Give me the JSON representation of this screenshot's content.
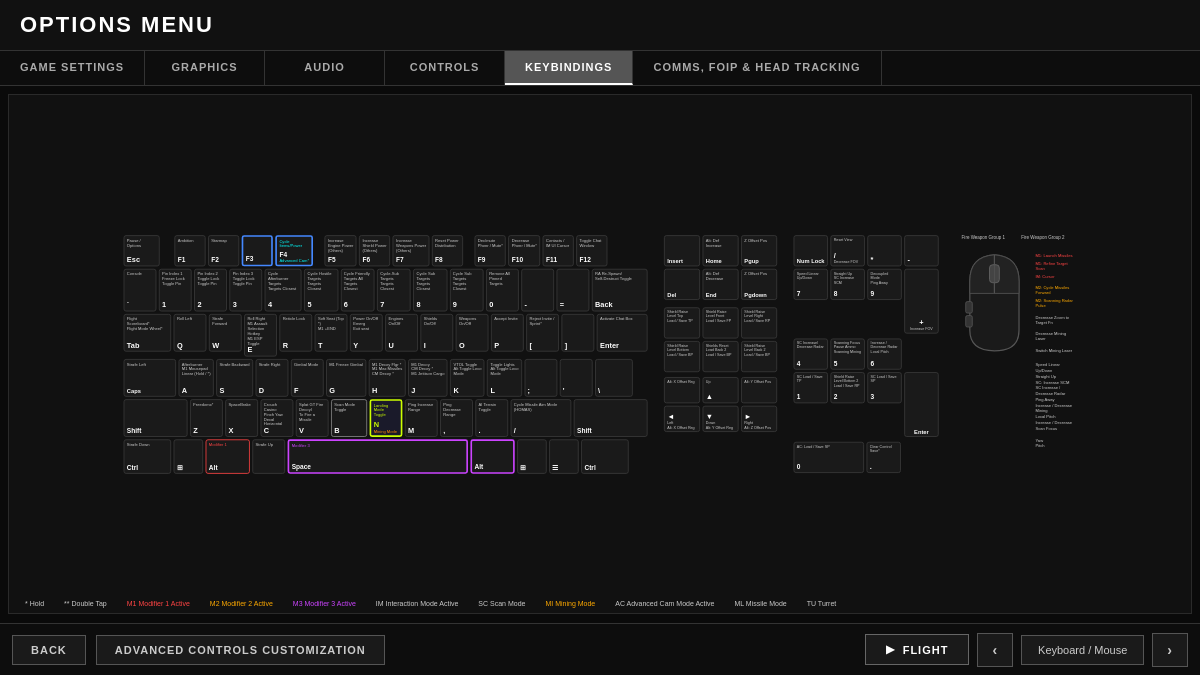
{
  "header": {
    "title": "OPTIONS MENU"
  },
  "nav": {
    "tabs": [
      {
        "label": "GAME SETTINGS",
        "active": false
      },
      {
        "label": "GRAPHICS",
        "active": false
      },
      {
        "label": "AUDIO",
        "active": false
      },
      {
        "label": "CONTROLS",
        "active": false
      },
      {
        "label": "KEYBINDINGS",
        "active": true
      },
      {
        "label": "COMMS, FOIP & HEAD TRACKING",
        "active": false
      }
    ]
  },
  "footer": {
    "back_label": "BACK",
    "advanced_label": "ADVANCED CONTROLS CUSTOMIZATION",
    "flight_label": "FLIGHT",
    "mode_label": "Keyboard / Mouse"
  },
  "legend": [
    {
      "symbol": "*",
      "text": "Hold"
    },
    {
      "symbol": "**",
      "text": "Double Tap"
    },
    {
      "symbol": "M1",
      "text": "Modifier 1 Active",
      "color": "#ff4444"
    },
    {
      "symbol": "M2",
      "text": "Modifier 2 Active",
      "color": "#ffaa00"
    },
    {
      "symbol": "M3",
      "text": "Modifier 3 Active",
      "color": "#cc44ff"
    },
    {
      "symbol": "IM",
      "text": "Interaction Mode Active"
    },
    {
      "symbol": "SC",
      "text": "Scan Mode"
    },
    {
      "symbol": "MI",
      "text": "Mining Mode"
    },
    {
      "symbol": "AC",
      "text": "Advanced Cam Mode Active"
    },
    {
      "symbol": "ML",
      "text": "Missile Mode"
    },
    {
      "symbol": "TU",
      "text": "Turret"
    }
  ]
}
